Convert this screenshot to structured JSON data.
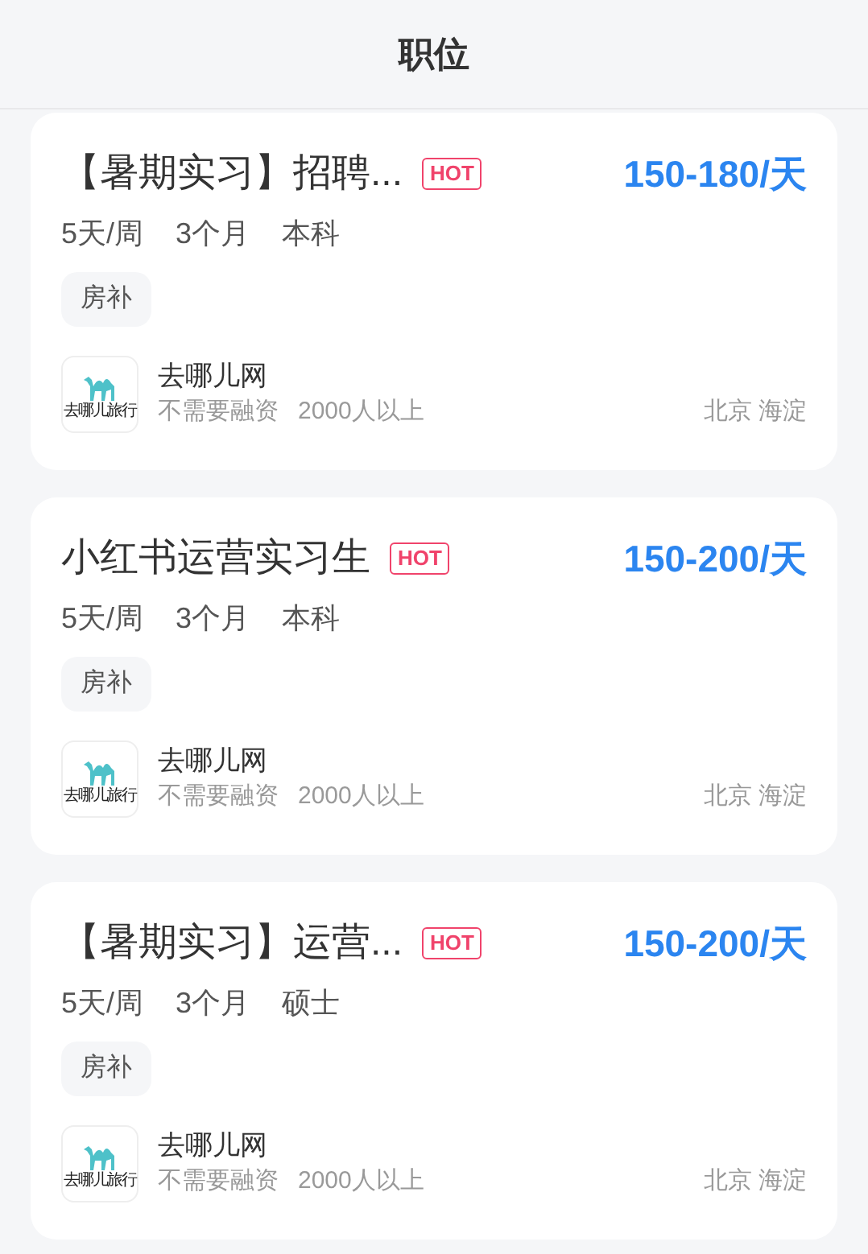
{
  "header": {
    "title": "职位"
  },
  "jobs": [
    {
      "title": "【暑期实习】招聘...",
      "hot": true,
      "hot_label": "HOT",
      "salary": "150-180/天",
      "meta": [
        "5天/周",
        "3个月",
        "本科"
      ],
      "tags": [
        "房补"
      ],
      "company": {
        "logo_text": "去哪儿旅行",
        "name": "去哪儿网",
        "funding": "不需要融资",
        "size": "2000人以上",
        "location": "北京 海淀"
      }
    },
    {
      "title": "小红书运营实习生",
      "hot": true,
      "hot_label": "HOT",
      "salary": "150-200/天",
      "meta": [
        "5天/周",
        "3个月",
        "本科"
      ],
      "tags": [
        "房补"
      ],
      "company": {
        "logo_text": "去哪儿旅行",
        "name": "去哪儿网",
        "funding": "不需要融资",
        "size": "2000人以上",
        "location": "北京 海淀"
      }
    },
    {
      "title": "【暑期实习】运营...",
      "hot": true,
      "hot_label": "HOT",
      "salary": "150-200/天",
      "meta": [
        "5天/周",
        "3个月",
        "硕士"
      ],
      "tags": [
        "房补"
      ],
      "company": {
        "logo_text": "去哪儿旅行",
        "name": "去哪儿网",
        "funding": "不需要融资",
        "size": "2000人以上",
        "location": "北京 海淀"
      }
    }
  ]
}
